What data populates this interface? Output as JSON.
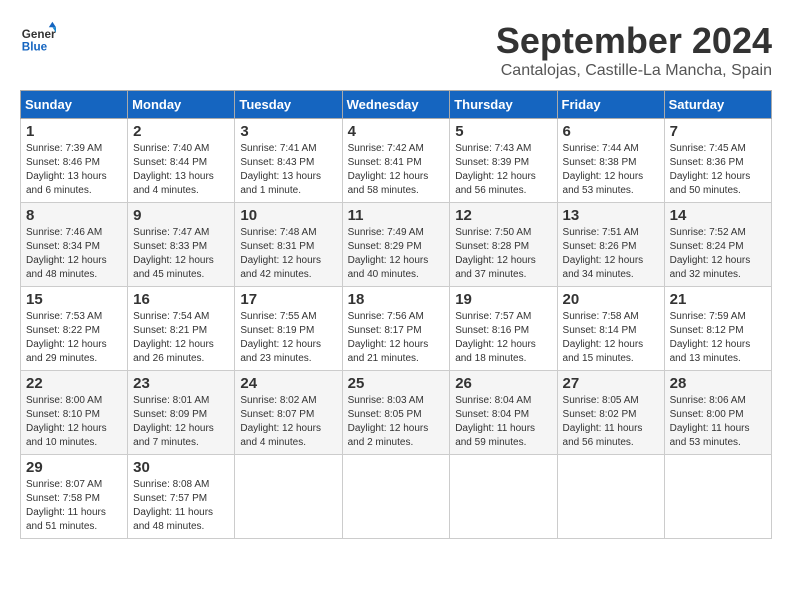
{
  "logo": {
    "general": "General",
    "blue": "Blue"
  },
  "title": {
    "month": "September 2024",
    "location": "Cantalojas, Castille-La Mancha, Spain"
  },
  "headers": [
    "Sunday",
    "Monday",
    "Tuesday",
    "Wednesday",
    "Thursday",
    "Friday",
    "Saturday"
  ],
  "weeks": [
    [
      {
        "day": "1",
        "sunrise": "Sunrise: 7:39 AM",
        "sunset": "Sunset: 8:46 PM",
        "daylight": "Daylight: 13 hours and 6 minutes."
      },
      {
        "day": "2",
        "sunrise": "Sunrise: 7:40 AM",
        "sunset": "Sunset: 8:44 PM",
        "daylight": "Daylight: 13 hours and 4 minutes."
      },
      {
        "day": "3",
        "sunrise": "Sunrise: 7:41 AM",
        "sunset": "Sunset: 8:43 PM",
        "daylight": "Daylight: 13 hours and 1 minute."
      },
      {
        "day": "4",
        "sunrise": "Sunrise: 7:42 AM",
        "sunset": "Sunset: 8:41 PM",
        "daylight": "Daylight: 12 hours and 58 minutes."
      },
      {
        "day": "5",
        "sunrise": "Sunrise: 7:43 AM",
        "sunset": "Sunset: 8:39 PM",
        "daylight": "Daylight: 12 hours and 56 minutes."
      },
      {
        "day": "6",
        "sunrise": "Sunrise: 7:44 AM",
        "sunset": "Sunset: 8:38 PM",
        "daylight": "Daylight: 12 hours and 53 minutes."
      },
      {
        "day": "7",
        "sunrise": "Sunrise: 7:45 AM",
        "sunset": "Sunset: 8:36 PM",
        "daylight": "Daylight: 12 hours and 50 minutes."
      }
    ],
    [
      {
        "day": "8",
        "sunrise": "Sunrise: 7:46 AM",
        "sunset": "Sunset: 8:34 PM",
        "daylight": "Daylight: 12 hours and 48 minutes."
      },
      {
        "day": "9",
        "sunrise": "Sunrise: 7:47 AM",
        "sunset": "Sunset: 8:33 PM",
        "daylight": "Daylight: 12 hours and 45 minutes."
      },
      {
        "day": "10",
        "sunrise": "Sunrise: 7:48 AM",
        "sunset": "Sunset: 8:31 PM",
        "daylight": "Daylight: 12 hours and 42 minutes."
      },
      {
        "day": "11",
        "sunrise": "Sunrise: 7:49 AM",
        "sunset": "Sunset: 8:29 PM",
        "daylight": "Daylight: 12 hours and 40 minutes."
      },
      {
        "day": "12",
        "sunrise": "Sunrise: 7:50 AM",
        "sunset": "Sunset: 8:28 PM",
        "daylight": "Daylight: 12 hours and 37 minutes."
      },
      {
        "day": "13",
        "sunrise": "Sunrise: 7:51 AM",
        "sunset": "Sunset: 8:26 PM",
        "daylight": "Daylight: 12 hours and 34 minutes."
      },
      {
        "day": "14",
        "sunrise": "Sunrise: 7:52 AM",
        "sunset": "Sunset: 8:24 PM",
        "daylight": "Daylight: 12 hours and 32 minutes."
      }
    ],
    [
      {
        "day": "15",
        "sunrise": "Sunrise: 7:53 AM",
        "sunset": "Sunset: 8:22 PM",
        "daylight": "Daylight: 12 hours and 29 minutes."
      },
      {
        "day": "16",
        "sunrise": "Sunrise: 7:54 AM",
        "sunset": "Sunset: 8:21 PM",
        "daylight": "Daylight: 12 hours and 26 minutes."
      },
      {
        "day": "17",
        "sunrise": "Sunrise: 7:55 AM",
        "sunset": "Sunset: 8:19 PM",
        "daylight": "Daylight: 12 hours and 23 minutes."
      },
      {
        "day": "18",
        "sunrise": "Sunrise: 7:56 AM",
        "sunset": "Sunset: 8:17 PM",
        "daylight": "Daylight: 12 hours and 21 minutes."
      },
      {
        "day": "19",
        "sunrise": "Sunrise: 7:57 AM",
        "sunset": "Sunset: 8:16 PM",
        "daylight": "Daylight: 12 hours and 18 minutes."
      },
      {
        "day": "20",
        "sunrise": "Sunrise: 7:58 AM",
        "sunset": "Sunset: 8:14 PM",
        "daylight": "Daylight: 12 hours and 15 minutes."
      },
      {
        "day": "21",
        "sunrise": "Sunrise: 7:59 AM",
        "sunset": "Sunset: 8:12 PM",
        "daylight": "Daylight: 12 hours and 13 minutes."
      }
    ],
    [
      {
        "day": "22",
        "sunrise": "Sunrise: 8:00 AM",
        "sunset": "Sunset: 8:10 PM",
        "daylight": "Daylight: 12 hours and 10 minutes."
      },
      {
        "day": "23",
        "sunrise": "Sunrise: 8:01 AM",
        "sunset": "Sunset: 8:09 PM",
        "daylight": "Daylight: 12 hours and 7 minutes."
      },
      {
        "day": "24",
        "sunrise": "Sunrise: 8:02 AM",
        "sunset": "Sunset: 8:07 PM",
        "daylight": "Daylight: 12 hours and 4 minutes."
      },
      {
        "day": "25",
        "sunrise": "Sunrise: 8:03 AM",
        "sunset": "Sunset: 8:05 PM",
        "daylight": "Daylight: 12 hours and 2 minutes."
      },
      {
        "day": "26",
        "sunrise": "Sunrise: 8:04 AM",
        "sunset": "Sunset: 8:04 PM",
        "daylight": "Daylight: 11 hours and 59 minutes."
      },
      {
        "day": "27",
        "sunrise": "Sunrise: 8:05 AM",
        "sunset": "Sunset: 8:02 PM",
        "daylight": "Daylight: 11 hours and 56 minutes."
      },
      {
        "day": "28",
        "sunrise": "Sunrise: 8:06 AM",
        "sunset": "Sunset: 8:00 PM",
        "daylight": "Daylight: 11 hours and 53 minutes."
      }
    ],
    [
      {
        "day": "29",
        "sunrise": "Sunrise: 8:07 AM",
        "sunset": "Sunset: 7:58 PM",
        "daylight": "Daylight: 11 hours and 51 minutes."
      },
      {
        "day": "30",
        "sunrise": "Sunrise: 8:08 AM",
        "sunset": "Sunset: 7:57 PM",
        "daylight": "Daylight: 11 hours and 48 minutes."
      },
      null,
      null,
      null,
      null,
      null
    ]
  ]
}
